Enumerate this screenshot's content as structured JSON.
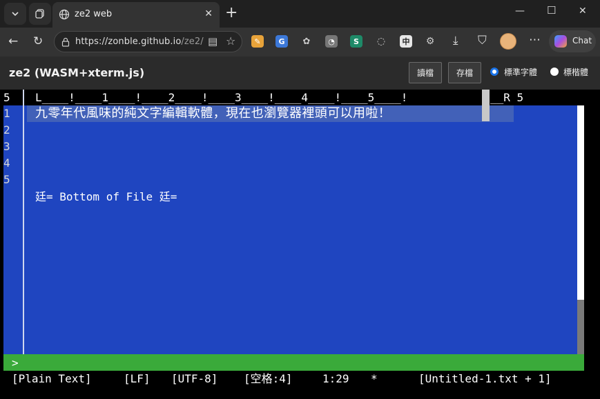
{
  "browser": {
    "tab_title": "ze2 web",
    "url_host": "https://zonble.github.io",
    "url_path": "/ze2/",
    "chat_label": "Chat"
  },
  "app": {
    "title": "ze2 (WASM+xterm.js)",
    "open_button": "讀檔",
    "save_button": "存檔",
    "font_options": [
      {
        "label": "標準字體",
        "selected": true
      },
      {
        "label": "標楷體",
        "selected": false
      }
    ]
  },
  "editor": {
    "ruler_prefix": "5",
    "ruler": "L____!____1____!____2____!____3____!____4____!____5____!",
    "ruler_suffix": "__R 5",
    "line_numbers": [
      "1",
      "2",
      "3",
      "4",
      "5"
    ],
    "lines": [
      "九零年代風味的純文字編輯軟體，現在也瀏覽器裡頭可以用啦！"
    ],
    "eof_marker": "廷= Bottom of File 廷=",
    "command_prompt": ">",
    "status": {
      "mode": "[Plain Text]",
      "line_ending": "[LF]",
      "encoding": "[UTF-8]",
      "indent": "[空格:4]",
      "position": "1:29",
      "modified": "*",
      "file": "[Untitled-1.txt + 1]"
    }
  },
  "colors": {
    "edit_bg": "#1f45c0",
    "current_line": "#4261b8",
    "command_bar": "#3aaa3a"
  }
}
